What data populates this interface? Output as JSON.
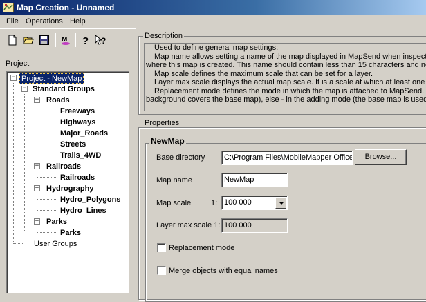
{
  "window": {
    "title": "Map Creation - Unnamed",
    "icon": "map-app-icon"
  },
  "menu": {
    "items": [
      "File",
      "Operations",
      "Help"
    ]
  },
  "toolbar": {
    "buttons": [
      {
        "name": "new-document-icon"
      },
      {
        "name": "open-folder-icon"
      },
      {
        "name": "save-disk-icon"
      },
      {
        "name": "mapsend-icon"
      },
      {
        "name": "help-icon"
      },
      {
        "name": "context-help-icon"
      }
    ]
  },
  "project": {
    "label": "Project",
    "tree": [
      {
        "text": "Project - NewMap",
        "selected": true
      },
      {
        "text": "Standard Groups"
      },
      {
        "text": "Roads"
      },
      {
        "text": "Freeways"
      },
      {
        "text": "Highways"
      },
      {
        "text": "Major_Roads"
      },
      {
        "text": "Streets"
      },
      {
        "text": "Trails_4WD"
      },
      {
        "text": "Railroads"
      },
      {
        "text": "Railroads"
      },
      {
        "text": "Hydrography"
      },
      {
        "text": "Hydro_Polygons"
      },
      {
        "text": "Hydro_Lines"
      },
      {
        "text": "Parks"
      },
      {
        "text": "Parks"
      },
      {
        "text": "User Groups"
      }
    ]
  },
  "description": {
    "title": "Description",
    "lines": [
      "Used to define general map settings:",
      "Map name allows setting a name of the map displayed in MapSend when inspecting",
      "where this map is created. This name should contain less than 15 characters and no sp",
      "Map scale defines the maximum scale that can be set for a layer.",
      "Layer max scale displays the actual map scale. It is a scale at which at least one m",
      "Replacement mode defines the mode in which the map is attached to MapSend. If th",
      "background covers the base map), else - in the adding mode (the base map is used as"
    ]
  },
  "properties": {
    "title": "Properties",
    "group_title": "NewMap",
    "base_directory_label": "Base directory",
    "base_directory_value": "C:\\Program Files\\MobileMapper Office",
    "browse_label": "Browse...",
    "map_name_label": "Map name",
    "map_name_value": "NewMap",
    "map_scale_label": "Map scale",
    "map_scale_prefix": "1:",
    "map_scale_value": "100 000",
    "layer_max_scale_label": "Layer max scale 1:",
    "layer_max_scale_value": "100 000",
    "replacement_mode_label": "Replacement mode",
    "replacement_mode_checked": false,
    "merge_objects_label": "Merge objects with equal names",
    "merge_objects_checked": false
  }
}
